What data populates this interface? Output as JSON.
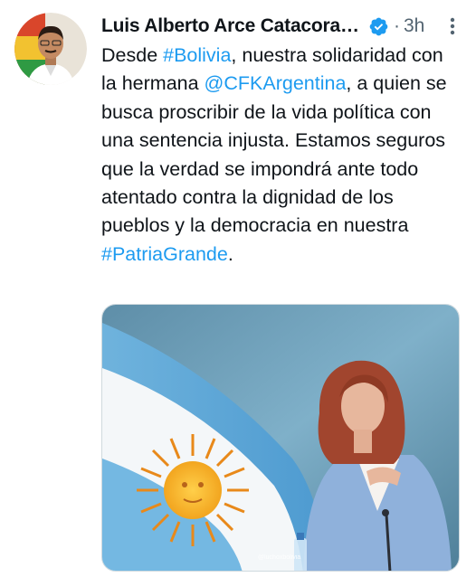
{
  "author": {
    "display_name": "Luis Alberto Arce Catacora (Lucho Arce)",
    "verified_icon": "verified-badge-icon",
    "time_separator": "·",
    "timestamp": "3h"
  },
  "tweet": {
    "text_1": "Desde ",
    "hashtag_1": "#Bolivia",
    "text_2": ", nuestra solidaridad con la hermana ",
    "mention_1": "@CFKArgentina",
    "text_3": ", a quien se busca proscribir de la vida política con una sentencia injusta. Estamos seguros que la verdad se impondrá ante todo atentado contra la dignidad de los pueblos y la democracia en nuestra ",
    "hashtag_2": "#PatriaGrande",
    "text_4": "."
  },
  "media": {
    "watermark": "@luchoxbolivia"
  },
  "colors": {
    "link": "#1d9bf0",
    "verified": "#1d9bf0",
    "secondary": "#536471"
  }
}
